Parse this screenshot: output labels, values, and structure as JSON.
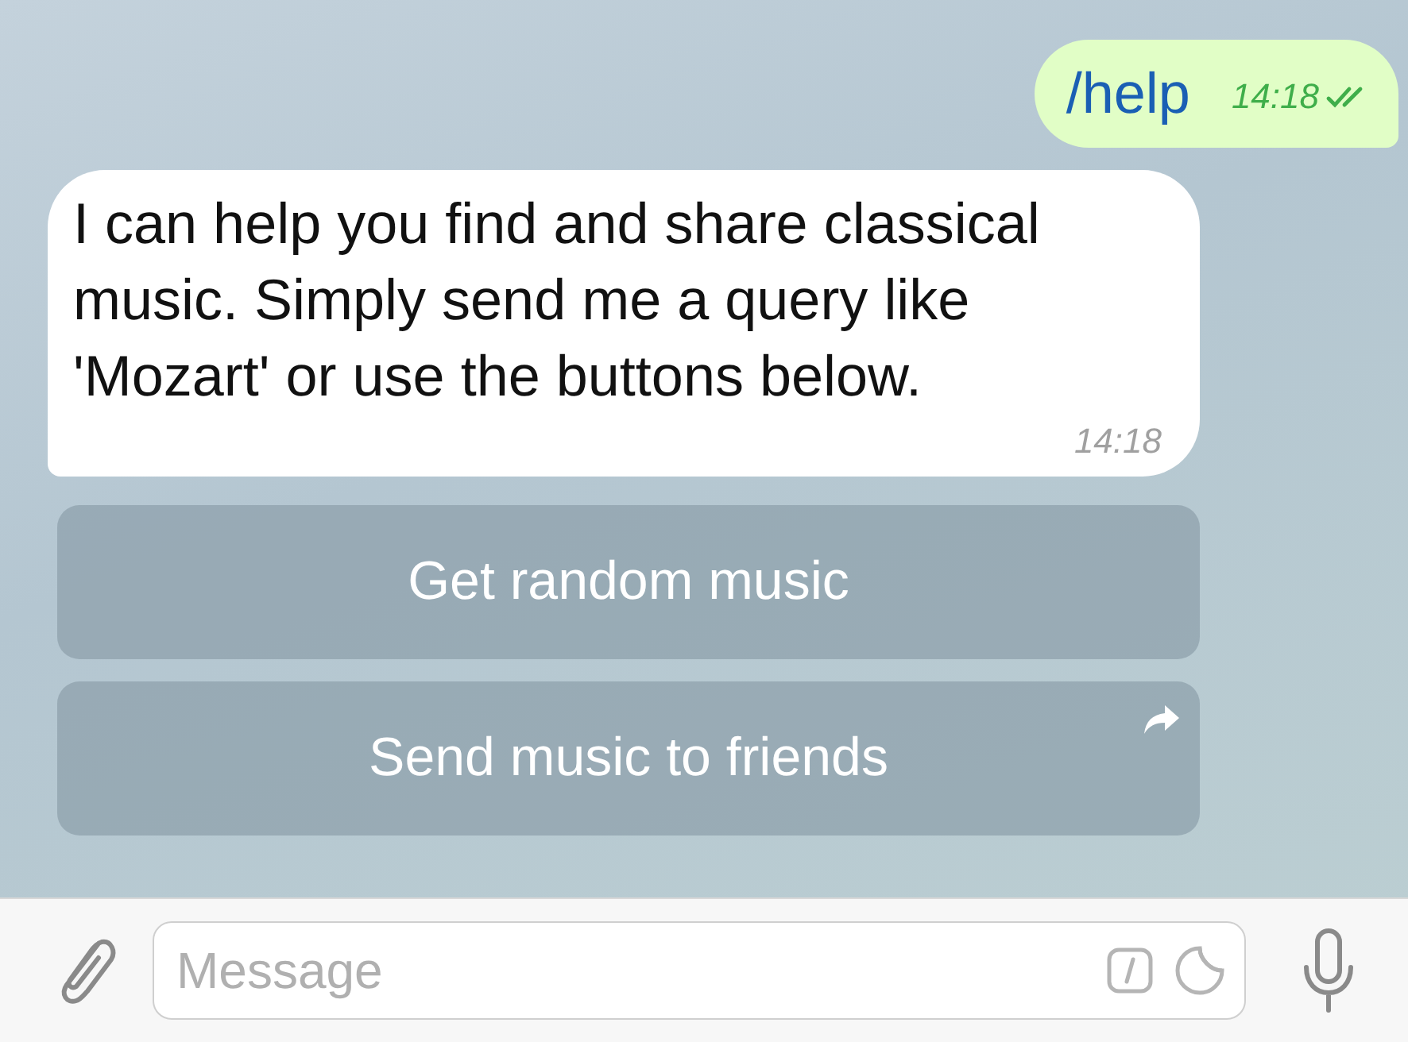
{
  "messages": [
    {
      "kind": "outgoing",
      "text": "/help",
      "time": "14:18",
      "read": true
    },
    {
      "kind": "incoming",
      "text": "I can help you find and share classical music. Simply send me a query like 'Mozart' or use the buttons below.",
      "time": "14:18"
    }
  ],
  "keyboard": [
    {
      "label": "Get random music",
      "kind": "plain"
    },
    {
      "label": "Send music to friends",
      "kind": "share"
    }
  ],
  "composer": {
    "placeholder": "Message"
  }
}
